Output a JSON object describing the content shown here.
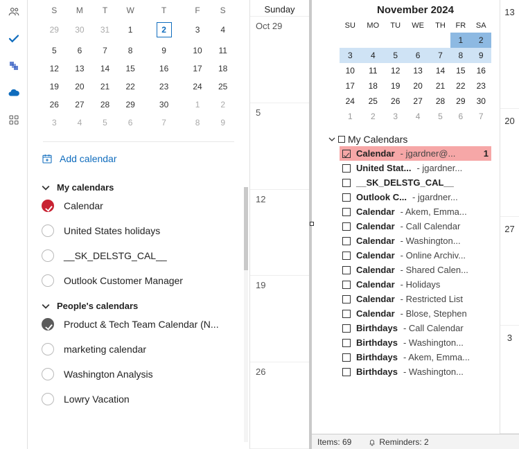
{
  "nav_rail": [
    "group-icon",
    "task-check-icon",
    "org-icon",
    "cloud-icon",
    "apps-icon"
  ],
  "left": {
    "mini_calendar": {
      "dow": [
        "S",
        "M",
        "T",
        "W",
        "T",
        "F",
        "S"
      ],
      "rows": [
        [
          {
            "v": "29",
            "dim": true
          },
          {
            "v": "30",
            "dim": true
          },
          {
            "v": "31",
            "dim": true
          },
          {
            "v": "1"
          },
          {
            "v": "2",
            "today": true
          },
          {
            "v": "3"
          },
          {
            "v": "4"
          }
        ],
        [
          {
            "v": "5"
          },
          {
            "v": "6"
          },
          {
            "v": "7"
          },
          {
            "v": "8"
          },
          {
            "v": "9"
          },
          {
            "v": "10"
          },
          {
            "v": "11"
          }
        ],
        [
          {
            "v": "12"
          },
          {
            "v": "13"
          },
          {
            "v": "14"
          },
          {
            "v": "15"
          },
          {
            "v": "16"
          },
          {
            "v": "17"
          },
          {
            "v": "18"
          }
        ],
        [
          {
            "v": "19"
          },
          {
            "v": "20"
          },
          {
            "v": "21"
          },
          {
            "v": "22"
          },
          {
            "v": "23"
          },
          {
            "v": "24"
          },
          {
            "v": "25"
          }
        ],
        [
          {
            "v": "26"
          },
          {
            "v": "27"
          },
          {
            "v": "28"
          },
          {
            "v": "29"
          },
          {
            "v": "30"
          },
          {
            "v": "1",
            "dim": true
          },
          {
            "v": "2",
            "dim": true
          }
        ],
        [
          {
            "v": "3",
            "dim": true
          },
          {
            "v": "4",
            "dim": true
          },
          {
            "v": "5",
            "dim": true
          },
          {
            "v": "6",
            "dim": true
          },
          {
            "v": "7",
            "dim": true
          },
          {
            "v": "8",
            "dim": true
          },
          {
            "v": "9",
            "dim": true
          }
        ]
      ]
    },
    "add_calendar": "Add calendar",
    "groups": [
      {
        "title": "My calendars",
        "items": [
          {
            "label": "Calendar",
            "state": "checked-red"
          },
          {
            "label": "United States holidays",
            "state": ""
          },
          {
            "label": "__SK_DELSTG_CAL__",
            "state": ""
          },
          {
            "label": "Outlook Customer Manager",
            "state": ""
          }
        ]
      },
      {
        "title": "People's calendars",
        "items": [
          {
            "label": "Product & Tech Team Calendar (N...",
            "state": "checked-gray"
          },
          {
            "label": "marketing calendar",
            "state": ""
          },
          {
            "label": "Washington Analysis",
            "state": ""
          },
          {
            "label": "Lowry Vacation",
            "state": ""
          }
        ]
      }
    ]
  },
  "mid": {
    "day_header": "Sunday",
    "slots": [
      "Oct 29",
      "5",
      "12",
      "19",
      "26"
    ]
  },
  "right": {
    "month_title": "November 2024",
    "dow": [
      "SU",
      "MO",
      "TU",
      "WE",
      "TH",
      "FR",
      "SA"
    ],
    "rows": [
      [
        {
          "v": ""
        },
        {
          "v": ""
        },
        {
          "v": ""
        },
        {
          "v": ""
        },
        {
          "v": ""
        },
        {
          "v": "1",
          "sel": true
        },
        {
          "v": "2",
          "sel": true
        }
      ],
      [
        {
          "v": "3",
          "hl": true
        },
        {
          "v": "4",
          "hl": true
        },
        {
          "v": "5",
          "hl": true
        },
        {
          "v": "6",
          "hl": true
        },
        {
          "v": "7",
          "hl": true
        },
        {
          "v": "8",
          "hl": true
        },
        {
          "v": "9",
          "hl": true
        }
      ],
      [
        {
          "v": "10"
        },
        {
          "v": "11"
        },
        {
          "v": "12"
        },
        {
          "v": "13"
        },
        {
          "v": "14"
        },
        {
          "v": "15"
        },
        {
          "v": "16"
        }
      ],
      [
        {
          "v": "17"
        },
        {
          "v": "18"
        },
        {
          "v": "19"
        },
        {
          "v": "20"
        },
        {
          "v": "21"
        },
        {
          "v": "22"
        },
        {
          "v": "23"
        }
      ],
      [
        {
          "v": "24"
        },
        {
          "v": "25"
        },
        {
          "v": "26"
        },
        {
          "v": "27"
        },
        {
          "v": "28"
        },
        {
          "v": "29"
        },
        {
          "v": "30"
        }
      ],
      [
        {
          "v": "1",
          "dim": true
        },
        {
          "v": "2",
          "dim": true
        },
        {
          "v": "3",
          "dim": true
        },
        {
          "v": "4",
          "dim": true
        },
        {
          "v": "5",
          "dim": true
        },
        {
          "v": "6",
          "dim": true
        },
        {
          "v": "7",
          "dim": true
        }
      ]
    ],
    "my_cal_header": "My Calendars",
    "cal_list": [
      {
        "name": "Calendar",
        "sub": " - jgardner@...",
        "checked": true,
        "selected": true,
        "badge": "1"
      },
      {
        "name": "United Stat...",
        "sub": " - jgardner...",
        "checked": false
      },
      {
        "name": "__SK_DELSTG_CAL__",
        "sub": "",
        "checked": false
      },
      {
        "name": "Outlook C...",
        "sub": "  - jgardner...",
        "checked": false
      },
      {
        "name": "Calendar",
        "sub": " - Akem, Emma...",
        "checked": false
      },
      {
        "name": "Calendar",
        "sub": " - Call Calendar",
        "checked": false
      },
      {
        "name": "Calendar",
        "sub": " - Washington...",
        "checked": false
      },
      {
        "name": "Calendar",
        "sub": " - Online Archiv...",
        "checked": false
      },
      {
        "name": "Calendar",
        "sub": " - Shared Calen...",
        "checked": false
      },
      {
        "name": "Calendar",
        "sub": " - Holidays",
        "checked": false
      },
      {
        "name": "Calendar",
        "sub": " - Restricted List",
        "checked": false
      },
      {
        "name": "Calendar",
        "sub": " - Blose, Stephen",
        "checked": false
      },
      {
        "name": "Birthdays",
        "sub": " - Call Calendar",
        "checked": false
      },
      {
        "name": "Birthdays",
        "sub": " - Washington...",
        "checked": false
      },
      {
        "name": "Birthdays",
        "sub": " - Akem, Emma...",
        "checked": false
      },
      {
        "name": "Birthdays",
        "sub": " - Washington...",
        "checked": false
      }
    ],
    "side_labels": [
      "13",
      "20",
      "27",
      "3"
    ]
  },
  "status": {
    "items": "Items: 69",
    "reminders": "Reminders: 2"
  }
}
